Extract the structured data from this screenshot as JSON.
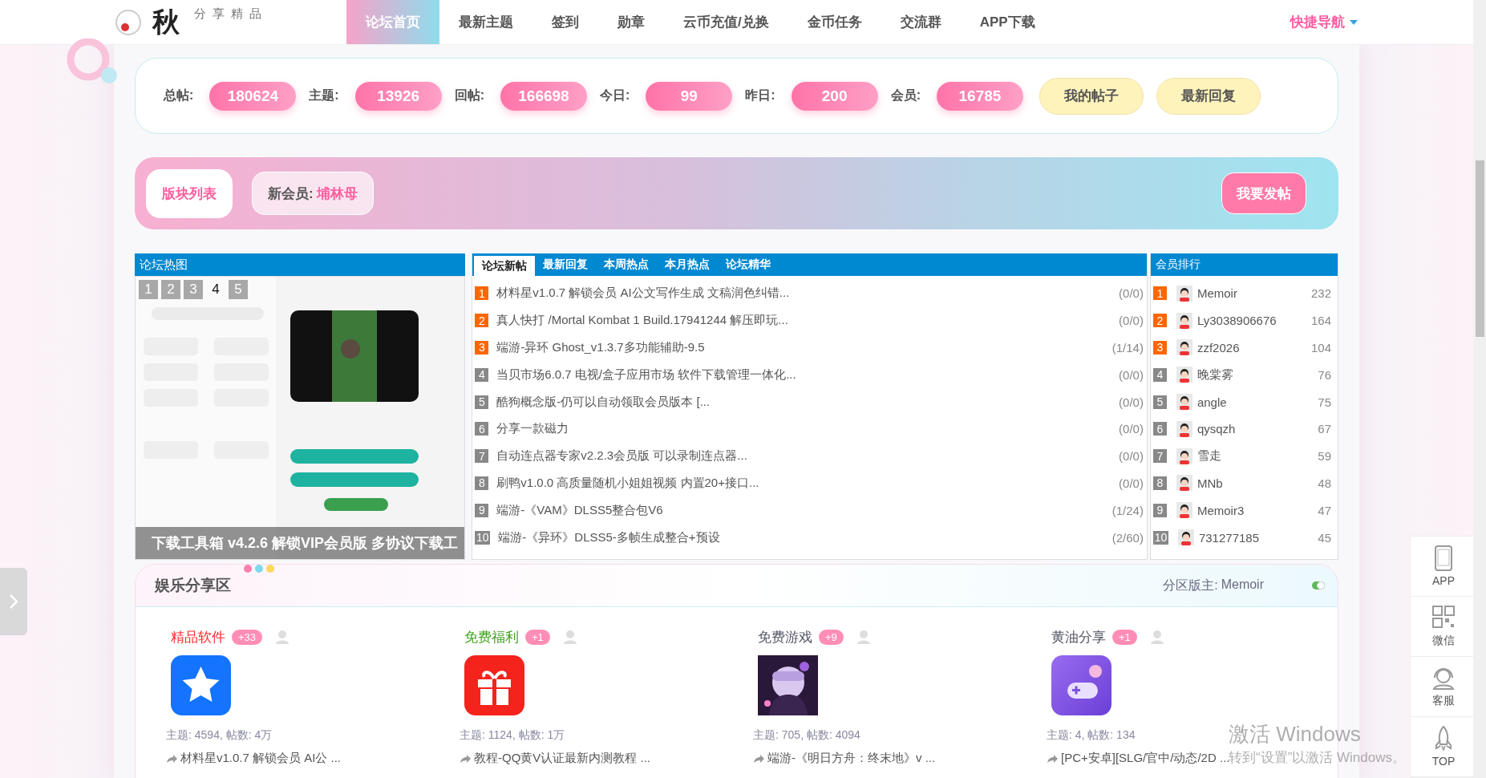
{
  "logo": {
    "mark": "秋",
    "tagline": "分享精品"
  },
  "nav": {
    "items": [
      {
        "label": "论坛首页",
        "selected": true
      },
      {
        "label": "最新主题",
        "selected": false
      },
      {
        "label": "签到",
        "selected": false
      },
      {
        "label": "勋章",
        "selected": false
      },
      {
        "label": "云币充值/兑换",
        "selected": false
      },
      {
        "label": "金币任务",
        "selected": false
      },
      {
        "label": "交流群",
        "selected": false
      },
      {
        "label": "APP下载",
        "selected": false
      }
    ],
    "quick_nav": "快捷导航"
  },
  "stats": {
    "items": [
      {
        "label": "总帖:",
        "value": "180624"
      },
      {
        "label": "主题:",
        "value": "13926"
      },
      {
        "label": "回帖:",
        "value": "166698"
      },
      {
        "label": "今日:",
        "value": "99"
      },
      {
        "label": "昨日:",
        "value": "200"
      },
      {
        "label": "会员:",
        "value": "16785"
      }
    ],
    "buttons": [
      "我的帖子",
      "最新回复"
    ]
  },
  "banner": {
    "forum_list": "版块列表",
    "new_member_label": "新会员:",
    "new_member": "埔林母",
    "post_button": "我要发帖"
  },
  "hot_images": {
    "title": "论坛热图",
    "slides": [
      {
        "label": "1",
        "selected": false
      },
      {
        "label": "2",
        "selected": false
      },
      {
        "label": "3",
        "selected": false
      },
      {
        "label": "4",
        "selected": true
      },
      {
        "label": "5",
        "selected": false
      }
    ],
    "caption": "下载工具箱 v4.2.6 解锁VIP会员版 多协议下载工"
  },
  "threads": {
    "tabs": [
      {
        "label": "论坛新帖",
        "selected": true
      },
      {
        "label": "最新回复",
        "selected": false
      },
      {
        "label": "本周热点",
        "selected": false
      },
      {
        "label": "本月热点",
        "selected": false
      },
      {
        "label": "论坛精华",
        "selected": false
      }
    ],
    "rows": [
      {
        "rank": "1",
        "highlight": true,
        "title": "材料星v1.0.7 解锁会员 AI公文写作生成 文稿润色纠错...",
        "stats": "(0/0)"
      },
      {
        "rank": "2",
        "highlight": true,
        "title": "真人快打 /Mortal Kombat 1 Build.17941244 解压即玩...",
        "stats": "(0/0)"
      },
      {
        "rank": "3",
        "highlight": true,
        "title": "端游-异环 Ghost_v1.3.7多功能辅助-9.5",
        "stats": "(1/14)"
      },
      {
        "rank": "4",
        "highlight": false,
        "title": "当贝市场6.0.7 电视/盒子应用市场 软件下载管理一体化...",
        "stats": "(0/0)"
      },
      {
        "rank": "5",
        "highlight": false,
        "title": "酷狗概念版-仍可以自动领取会员版本 [...",
        "stats": "(0/0)"
      },
      {
        "rank": "6",
        "highlight": false,
        "title": "分享一款磁力",
        "stats": "(0/0)"
      },
      {
        "rank": "7",
        "highlight": false,
        "title": "自动连点器专家v2.2.3会员版 可以录制连点器...",
        "stats": "(0/0)"
      },
      {
        "rank": "8",
        "highlight": false,
        "title": "刷鸭v1.0.0 高质量随机小姐姐视频 内置20+接口...",
        "stats": "(0/0)"
      },
      {
        "rank": "9",
        "highlight": false,
        "title": "端游-《VAM》DLSS5整合包V6",
        "stats": "(1/24)"
      },
      {
        "rank": "10",
        "highlight": false,
        "title": "端游-《异环》DLSS5-多帧生成整合+预设",
        "stats": "(2/60)"
      }
    ]
  },
  "members": {
    "title": "会员排行",
    "rows": [
      {
        "rank": "1",
        "highlight": true,
        "name": "Memoir",
        "count": "232"
      },
      {
        "rank": "2",
        "highlight": true,
        "name": "Ly3038906676",
        "count": "164"
      },
      {
        "rank": "3",
        "highlight": true,
        "name": "zzf2026",
        "count": "104"
      },
      {
        "rank": "4",
        "highlight": false,
        "name": "晚棠雾",
        "count": "76"
      },
      {
        "rank": "5",
        "highlight": false,
        "name": "angle",
        "count": "75"
      },
      {
        "rank": "6",
        "highlight": false,
        "name": "qysqzh",
        "count": "67"
      },
      {
        "rank": "7",
        "highlight": false,
        "name": "雪走",
        "count": "59"
      },
      {
        "rank": "8",
        "highlight": false,
        "name": "MNb",
        "count": "48"
      },
      {
        "rank": "9",
        "highlight": false,
        "name": "Memoir3",
        "count": "47"
      },
      {
        "rank": "10",
        "highlight": false,
        "name": "731277185",
        "count": "45"
      }
    ]
  },
  "section": {
    "title": "娱乐分享区",
    "moderator_label": "分区版主:",
    "moderator": "Memoir",
    "forums": [
      {
        "name": "精品软件",
        "color": "#ff2a2a",
        "badge": "+33",
        "kind": "star",
        "stats": "主题: 4594, 帖数: 4万",
        "latest": "材料星v1.0.7 解锁会员 AI公 ..."
      },
      {
        "name": "免费福利",
        "color": "#3fa31c",
        "badge": "+1",
        "kind": "gift",
        "stats": "主题: 1124, 帖数: 1万",
        "latest": "教程-QQ黄V认证最新内测教程 ..."
      },
      {
        "name": "免费游戏",
        "color": "#555566",
        "badge": "+9",
        "kind": "picture",
        "stats": "主题: 705, 帖数: 4094",
        "latest": "端游-《明日方舟：终末地》v ..."
      },
      {
        "name": "黄油分享",
        "color": "#555566",
        "badge": "+1",
        "kind": "gamepad",
        "stats": "主题: 4, 帖数: 134",
        "latest": "[PC+安卓][SLG/官中/动态/2D ..."
      }
    ]
  },
  "side_tools": [
    {
      "label": "APP",
      "kind": "phone"
    },
    {
      "label": "微信",
      "kind": "qr"
    },
    {
      "label": "客服",
      "kind": "headset"
    },
    {
      "label": "TOP",
      "kind": "rocket"
    }
  ],
  "windows_notice": {
    "title": "激活 Windows",
    "text": "转到“设置”以激活 Windows。"
  }
}
